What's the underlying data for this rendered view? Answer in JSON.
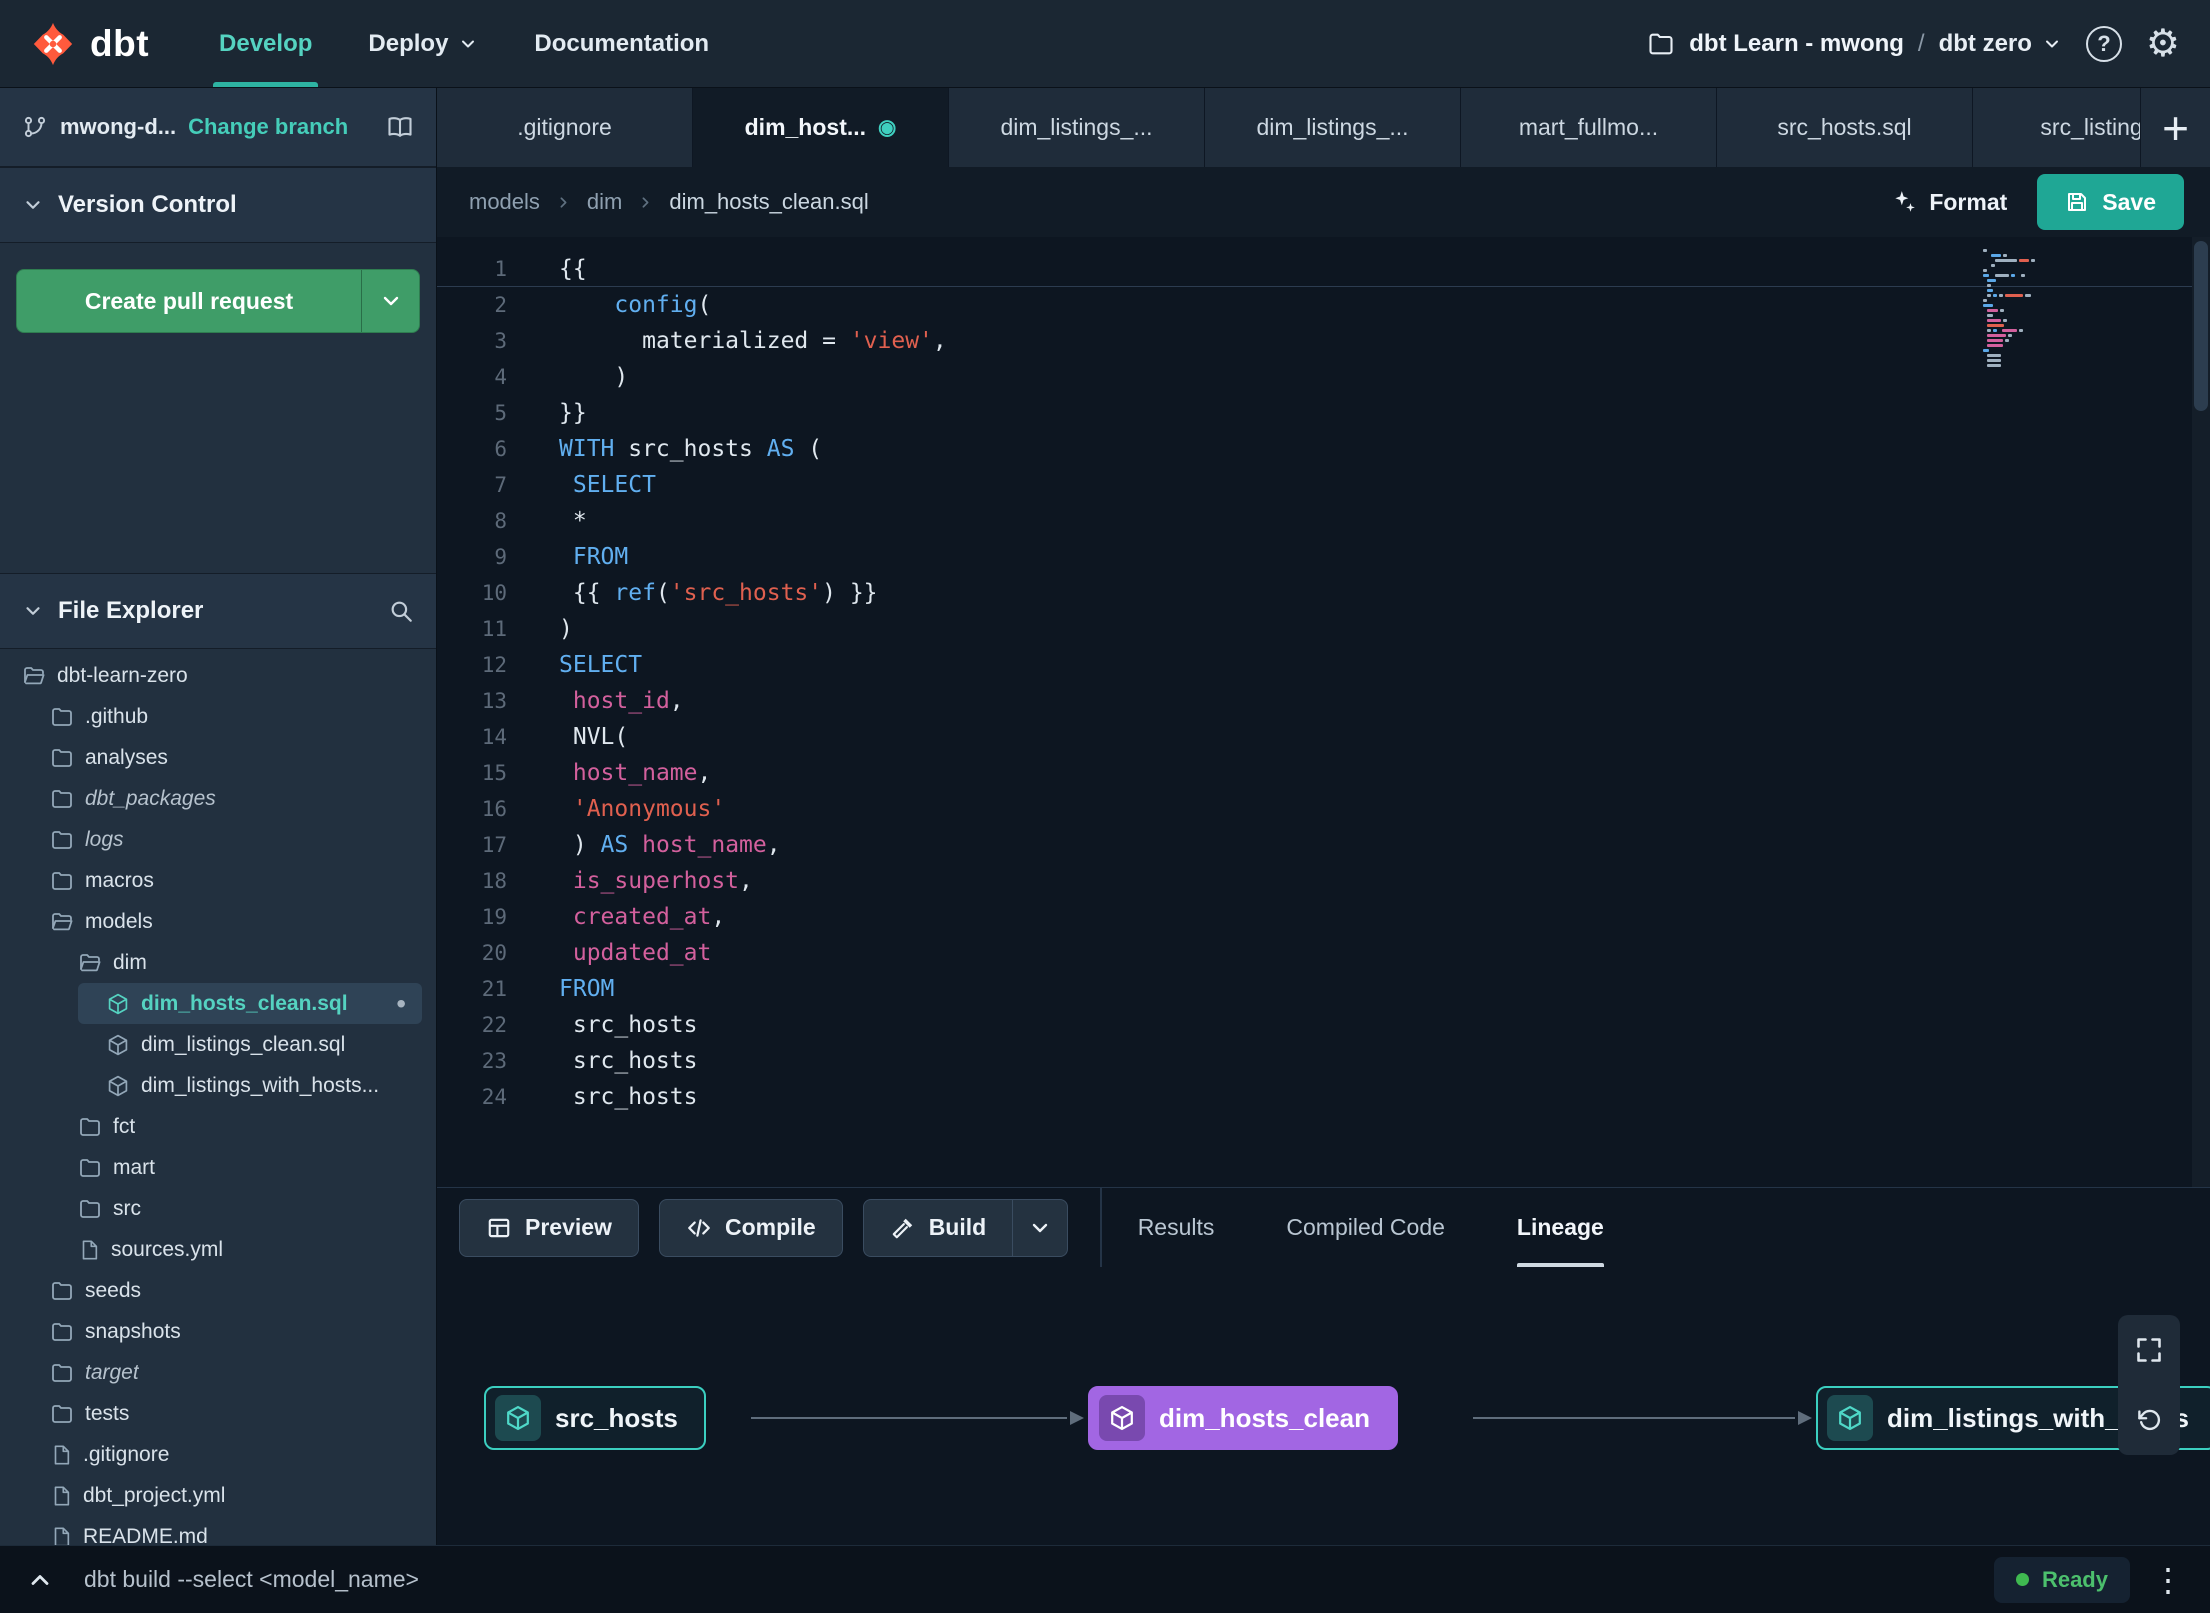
{
  "colors": {
    "brand_orange": "#ff5a3d",
    "accent_teal": "#2eb3a2",
    "pr_button_green": "#3f9d68",
    "lineage_node_purple": "#a266e3",
    "ready_green": "#3fb950"
  },
  "topnav": {
    "logo_text": "dbt",
    "develop_label": "Develop",
    "deploy_label": "Deploy",
    "documentation_label": "Documentation",
    "account_label": "dbt Learn - mwong",
    "path_separator": "/",
    "project_label": "dbt zero"
  },
  "sidebar": {
    "branch_name": "mwong-d...",
    "change_branch_label": "Change branch",
    "version_control_title": "Version Control",
    "create_pr_label": "Create pull request",
    "file_explorer_title": "File Explorer",
    "tree": [
      {
        "label": "dbt-learn-zero",
        "icon": "folder-open",
        "depth": 0
      },
      {
        "label": ".github",
        "icon": "folder",
        "depth": 1
      },
      {
        "label": "analyses",
        "icon": "folder",
        "depth": 1
      },
      {
        "label": "dbt_packages",
        "icon": "folder",
        "depth": 1,
        "italic": true
      },
      {
        "label": "logs",
        "icon": "folder",
        "depth": 1,
        "italic": true
      },
      {
        "label": "macros",
        "icon": "folder",
        "depth": 1
      },
      {
        "label": "models",
        "icon": "folder-open",
        "depth": 1
      },
      {
        "label": "dim",
        "icon": "folder-open",
        "depth": 2
      },
      {
        "label": "dim_hosts_clean.sql",
        "icon": "cube",
        "depth": 3,
        "selected": true,
        "modified": true
      },
      {
        "label": "dim_listings_clean.sql",
        "icon": "cube",
        "depth": 3
      },
      {
        "label": "dim_listings_with_hosts...",
        "icon": "cube",
        "depth": 3
      },
      {
        "label": "fct",
        "icon": "folder",
        "depth": 2
      },
      {
        "label": "mart",
        "icon": "folder",
        "depth": 2
      },
      {
        "label": "src",
        "icon": "folder",
        "depth": 2
      },
      {
        "label": "sources.yml",
        "icon": "file",
        "depth": 2
      },
      {
        "label": "seeds",
        "icon": "folder",
        "depth": 1
      },
      {
        "label": "snapshots",
        "icon": "folder",
        "depth": 1
      },
      {
        "label": "target",
        "icon": "folder",
        "depth": 1,
        "italic": true
      },
      {
        "label": "tests",
        "icon": "folder",
        "depth": 1
      },
      {
        "label": ".gitignore",
        "icon": "file",
        "depth": 1
      },
      {
        "label": "dbt_project.yml",
        "icon": "file",
        "depth": 1
      },
      {
        "label": "README.md",
        "icon": "file",
        "depth": 1
      }
    ]
  },
  "tabs": {
    "add_label": "+",
    "items": [
      {
        "label": ".gitignore"
      },
      {
        "label": "dim_host...",
        "active": true,
        "dot": true
      },
      {
        "label": "dim_listings_..."
      },
      {
        "label": "dim_listings_..."
      },
      {
        "label": "mart_fullmo..."
      },
      {
        "label": "src_hosts.sql"
      },
      {
        "label": "src_listings."
      }
    ]
  },
  "editor": {
    "breadcrumb": [
      "models",
      "dim",
      "dim_hosts_clean.sql"
    ],
    "format_label": "Format",
    "save_label": "Save",
    "lines": [
      {
        "n": 1,
        "hl": true,
        "t": [
          [
            "{{",
            "p"
          ]
        ]
      },
      {
        "n": 2,
        "t": [
          [
            "    ",
            "p"
          ],
          [
            "config",
            "k"
          ],
          [
            "(",
            "p"
          ]
        ]
      },
      {
        "n": 3,
        "t": [
          [
            "      ",
            "p"
          ],
          [
            "materialized = ",
            "p"
          ],
          [
            "'view'",
            "s"
          ],
          [
            ",",
            "p"
          ]
        ]
      },
      {
        "n": 4,
        "t": [
          [
            "    )",
            "p"
          ]
        ]
      },
      {
        "n": 5,
        "t": [
          [
            "}}",
            "p"
          ]
        ]
      },
      {
        "n": 6,
        "t": [
          [
            "WITH",
            "k"
          ],
          [
            " src_hosts ",
            "p"
          ],
          [
            "AS",
            "k"
          ],
          [
            " (",
            "p"
          ]
        ]
      },
      {
        "n": 7,
        "t": [
          [
            " ",
            "p"
          ],
          [
            "SELECT",
            "k"
          ]
        ]
      },
      {
        "n": 8,
        "t": [
          [
            " *",
            "p"
          ]
        ]
      },
      {
        "n": 9,
        "t": [
          [
            " ",
            "p"
          ],
          [
            "FROM",
            "k"
          ]
        ]
      },
      {
        "n": 10,
        "t": [
          [
            " {{ ",
            "p"
          ],
          [
            "ref",
            "k"
          ],
          [
            "(",
            "p"
          ],
          [
            "'src_hosts'",
            "s"
          ],
          [
            ") }}",
            "p"
          ]
        ]
      },
      {
        "n": 11,
        "t": [
          [
            ")",
            "p"
          ]
        ]
      },
      {
        "n": 12,
        "t": [
          [
            "SELECT",
            "k"
          ]
        ]
      },
      {
        "n": 13,
        "t": [
          [
            " ",
            "p"
          ],
          [
            "host_id",
            "i"
          ],
          [
            ",",
            "p"
          ]
        ]
      },
      {
        "n": 14,
        "t": [
          [
            " NVL(",
            "p"
          ]
        ]
      },
      {
        "n": 15,
        "t": [
          [
            " ",
            "p"
          ],
          [
            "host_name",
            "i"
          ],
          [
            ",",
            "p"
          ]
        ]
      },
      {
        "n": 16,
        "t": [
          [
            " ",
            "p"
          ],
          [
            "'Anonymous'",
            "s"
          ]
        ]
      },
      {
        "n": 17,
        "t": [
          [
            " ) ",
            "p"
          ],
          [
            "AS",
            "k"
          ],
          [
            " ",
            "p"
          ],
          [
            "host_name",
            "i"
          ],
          [
            ",",
            "p"
          ]
        ]
      },
      {
        "n": 18,
        "t": [
          [
            " ",
            "p"
          ],
          [
            "is_superhost",
            "i"
          ],
          [
            ",",
            "p"
          ]
        ]
      },
      {
        "n": 19,
        "t": [
          [
            " ",
            "p"
          ],
          [
            "created_at",
            "i"
          ],
          [
            ",",
            "p"
          ]
        ]
      },
      {
        "n": 20,
        "t": [
          [
            " ",
            "p"
          ],
          [
            "updated_at",
            "i"
          ]
        ]
      },
      {
        "n": 21,
        "t": [
          [
            "FROM",
            "k"
          ]
        ]
      },
      {
        "n": 22,
        "t": [
          [
            " src_hosts",
            "p"
          ]
        ]
      },
      {
        "n": 23,
        "t": [
          [
            " src_hosts",
            "p"
          ]
        ]
      },
      {
        "n": 24,
        "t": [
          [
            " src_hosts",
            "p"
          ]
        ]
      }
    ]
  },
  "runbar": {
    "preview_label": "Preview",
    "compile_label": "Compile",
    "build_label": "Build",
    "tabs": [
      "Results",
      "Compiled Code",
      "Lineage"
    ],
    "active_tab": "Lineage"
  },
  "lineage": {
    "nodes": [
      {
        "label": "src_hosts",
        "variant": "teal"
      },
      {
        "label": "dim_hosts_clean",
        "variant": "purple"
      },
      {
        "label": "dim_listings_with_hosts",
        "variant": "teal"
      }
    ]
  },
  "statusbar": {
    "command": "dbt build --select <model_name>",
    "status": "Ready"
  }
}
